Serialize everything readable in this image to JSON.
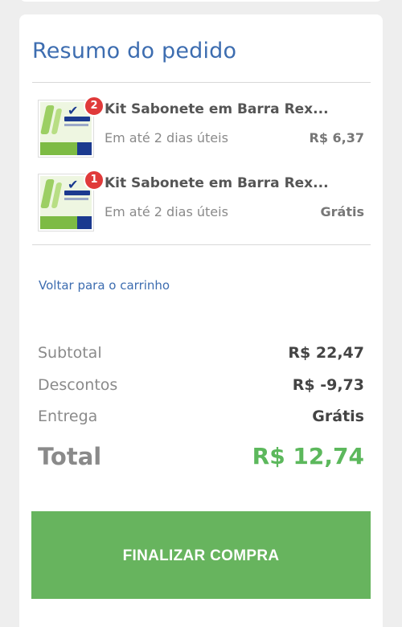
{
  "order_summary": {
    "title": "Resumo do pedido",
    "items": [
      {
        "quantity": "2",
        "name": "Kit Sabonete em Barra Rex...",
        "delivery": "Em até 2 dias úteis",
        "price": "R$ 6,37"
      },
      {
        "quantity": "1",
        "name": "Kit Sabonete em Barra Rex...",
        "delivery": "Em até 2 dias úteis",
        "price": "Grátis"
      }
    ],
    "back_link": "Voltar para o carrinho",
    "totals": {
      "subtotal_label": "Subtotal",
      "subtotal_value": "R$ 22,47",
      "discounts_label": "Descontos",
      "discounts_value": "R$ -9,73",
      "delivery_label": "Entrega",
      "delivery_value": "Grátis",
      "total_label": "Total",
      "total_value": "R$ 12,74"
    },
    "checkout_button": "FINALIZAR COMPRA"
  },
  "colors": {
    "title_blue": "#3d6db0",
    "total_green": "#5cb85c",
    "button_green": "#67b45e",
    "badge_red": "#e03a3a"
  }
}
